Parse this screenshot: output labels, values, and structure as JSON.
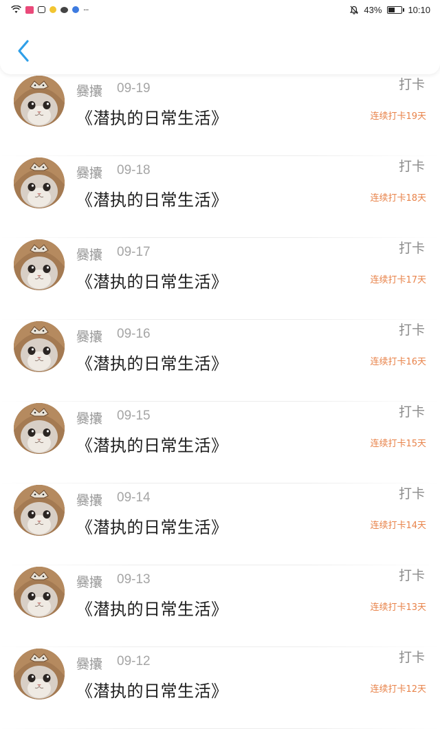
{
  "status_bar": {
    "battery_percent": "43%",
    "time": "10:10",
    "more_indicator": "···"
  },
  "header": {
    "back_icon": "chevron-left-icon"
  },
  "colors": {
    "accent_blue": "#2f9fe8",
    "streak_orange": "#e8834a"
  },
  "entries": [
    {
      "name": "爨攮",
      "date": "09-19",
      "title": "《潜执的日常生活》",
      "action": "打卡",
      "streak": "连续打卡19天"
    },
    {
      "name": "爨攮",
      "date": "09-18",
      "title": "《潜执的日常生活》",
      "action": "打卡",
      "streak": "连续打卡18天"
    },
    {
      "name": "爨攮",
      "date": "09-17",
      "title": "《潜执的日常生活》",
      "action": "打卡",
      "streak": "连续打卡17天"
    },
    {
      "name": "爨攮",
      "date": "09-16",
      "title": "《潜执的日常生活》",
      "action": "打卡",
      "streak": "连续打卡16天"
    },
    {
      "name": "爨攮",
      "date": "09-15",
      "title": "《潜执的日常生活》",
      "action": "打卡",
      "streak": "连续打卡15天"
    },
    {
      "name": "爨攮",
      "date": "09-14",
      "title": "《潜执的日常生活》",
      "action": "打卡",
      "streak": "连续打卡14天"
    },
    {
      "name": "爨攮",
      "date": "09-13",
      "title": "《潜执的日常生活》",
      "action": "打卡",
      "streak": "连续打卡13天"
    },
    {
      "name": "爨攮",
      "date": "09-12",
      "title": "《潜执的日常生活》",
      "action": "打卡",
      "streak": "连续打卡12天"
    }
  ]
}
